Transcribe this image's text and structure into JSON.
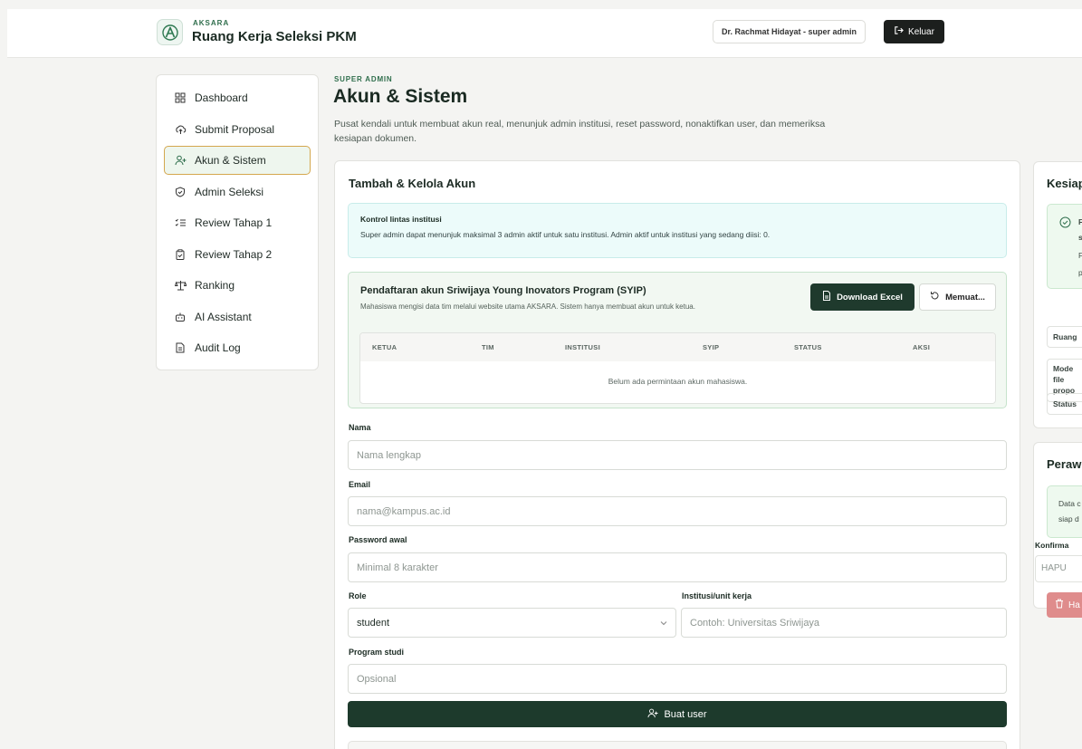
{
  "header": {
    "brand_small": "AKSARA",
    "brand_title": "Ruang Kerja Seleksi PKM",
    "user_chip": "Dr. Rachmat Hidayat - super admin",
    "logout_label": "Keluar"
  },
  "sidebar": {
    "items": [
      {
        "label": "Dashboard",
        "icon": "dashboard-grid-icon"
      },
      {
        "label": "Submit Proposal",
        "icon": "upload-cloud-icon"
      },
      {
        "label": "Akun & Sistem",
        "icon": "user-plus-icon",
        "active": true
      },
      {
        "label": "Admin Seleksi",
        "icon": "shield-check-icon"
      },
      {
        "label": "Review Tahap 1",
        "icon": "list-check-icon"
      },
      {
        "label": "Review Tahap 2",
        "icon": "clipboard-check-icon"
      },
      {
        "label": "Ranking",
        "icon": "scale-icon"
      },
      {
        "label": "AI Assistant",
        "icon": "bot-icon"
      },
      {
        "label": "Audit Log",
        "icon": "file-text-icon"
      }
    ]
  },
  "page": {
    "eyebrow": "SUPER ADMIN",
    "title": "Akun & Sistem",
    "description": "Pusat kendali untuk membuat akun real, menunjuk admin institusi, reset password, nonaktifkan user, dan memeriksa kesiapan dokumen."
  },
  "main_card": {
    "title": "Tambah & Kelola Akun",
    "info_title": "Kontrol lintas institusi",
    "info_text": "Super admin dapat menunjuk maksimal 3 admin aktif untuk satu institusi. Admin aktif untuk institusi yang sedang diisi: 0.",
    "registration": {
      "title": "Pendaftaran akun Sriwijaya Young Inovators Program (SYIP)",
      "subtitle": "Mahasiswa mengisi data tim melalui website utama AKSARA. Sistem hanya membuat akun untuk ketua.",
      "download_label": "Download Excel",
      "load_label": "Memuat...",
      "columns": [
        "KETUA",
        "TIM",
        "INSTITUSI",
        "SYIP",
        "STATUS",
        "AKSI"
      ],
      "empty_text": "Belum ada permintaan akun mahasiswa."
    },
    "form": {
      "name_label": "Nama",
      "name_placeholder": "Nama lengkap",
      "email_label": "Email",
      "email_placeholder": "nama@kampus.ac.id",
      "password_label": "Password awal",
      "password_placeholder": "Minimal 8 karakter",
      "role_label": "Role",
      "role_value": "student",
      "institution_label": "Institusi/unit kerja",
      "institution_placeholder": "Contoh: Universitas Sriwijaya",
      "program_label": "Program studi",
      "program_placeholder": "Opsional",
      "submit_label": "Buat user"
    }
  },
  "right_panel": {
    "readiness_title": "Kesiap",
    "readiness_lines": [
      "F",
      "s",
      "F",
      "p"
    ],
    "row1": "Ruang",
    "row2_lines": [
      "Mode",
      "file",
      "propo"
    ],
    "row3": "Status",
    "maintenance_title": "Peraw",
    "maint_lines": [
      "Data c",
      "siap d"
    ],
    "confirm_label": "Konfirma",
    "confirm_placeholder": "HAPU",
    "delete_label": "Ha"
  }
}
